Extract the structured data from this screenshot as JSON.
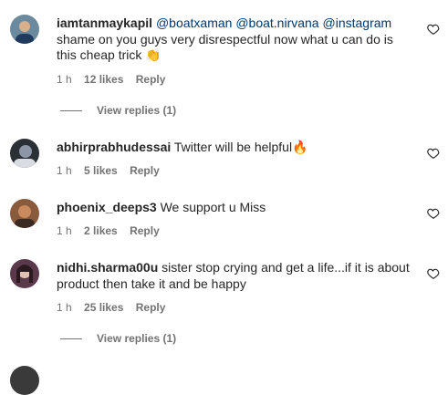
{
  "comments": [
    {
      "username": "iamtanmaykapil",
      "mentions": [
        "@boatxaman",
        "@boat.nirvana",
        "@instagram"
      ],
      "text": "shame on you guys very disrespectful now what u can do is this cheap trick",
      "emoji": "👏",
      "time": "1 h",
      "likes": "12 likes",
      "reply": "Reply",
      "view_replies": "View replies (1)",
      "avatar_colors": [
        "#6c8a9e",
        "#d8b08c"
      ]
    },
    {
      "username": "abhirprabhudessai",
      "text": "Twitter will be helpful",
      "emoji": "🔥",
      "time": "1 h",
      "likes": "5 likes",
      "reply": "Reply",
      "avatar_colors": [
        "#2b2f36",
        "#8c96a6"
      ]
    },
    {
      "username": "phoenix_deeps3",
      "text": "We support u Miss",
      "time": "1 h",
      "likes": "2 likes",
      "reply": "Reply",
      "avatar_colors": [
        "#8a5a3c",
        "#c98a5e"
      ]
    },
    {
      "username": "nidhi.sharma00u",
      "text": "sister stop crying and get a life...if it is about product then take it and be happy",
      "time": "1 h",
      "likes": "25 likes",
      "reply": "Reply",
      "view_replies": "View replies (1)",
      "avatar_colors": [
        "#5a3a4a",
        "#e0c1b4"
      ]
    }
  ],
  "icons": {
    "like": "heart-outline-icon"
  }
}
